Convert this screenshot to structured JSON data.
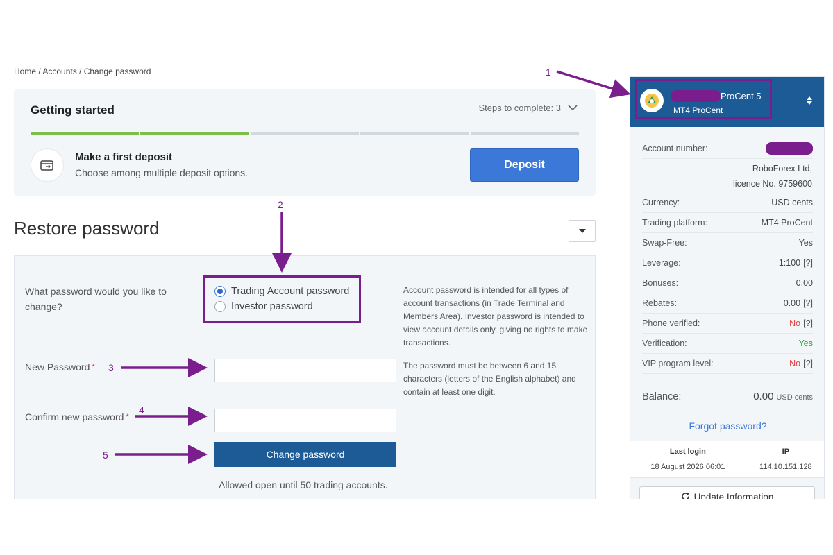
{
  "breadcrumb": "Home / Accounts / Change password",
  "getting_started": {
    "title": "Getting started",
    "steps_label": "Steps to complete: 3",
    "progress": {
      "completed": 2,
      "total": 5
    },
    "deposit_title": "Make a first deposit",
    "deposit_subtitle": "Choose among multiple deposit options.",
    "deposit_button": "Deposit"
  },
  "restore": {
    "title": "Restore password",
    "question": "What password would you like to change?",
    "options": [
      {
        "label": "Trading Account password",
        "selected": true
      },
      {
        "label": "Investor password",
        "selected": false
      }
    ],
    "help_account": "Account password is intended for all types of account transactions (in Trade Terminal and Members Area). Investor password is intended to view account details only, giving no rights to make transactions.",
    "new_password_label": "New Password",
    "confirm_password_label": "Confirm new password",
    "required_mark": "*",
    "help_password": "The password must be between 6 and 15 characters (letters of the English alphabet) and contain at least one digit.",
    "change_button": "Change password",
    "allowed_note": "Allowed open until 50 trading accounts."
  },
  "annotations": [
    "1",
    "2",
    "3",
    "4",
    "5"
  ],
  "account": {
    "name_suffix": "ProCent 5",
    "platform_badge": "MT4 ProCent",
    "number_label": "Account number:",
    "company": "RoboForex Ltd,",
    "licence": "licence No. 9759600",
    "rows": [
      {
        "label": "Currency:",
        "value": "USD cents"
      },
      {
        "label": "Trading platform:",
        "value": "MT4 ProCent"
      },
      {
        "label": "Swap-Free:",
        "value": "Yes"
      },
      {
        "label": "Leverage:",
        "value": "1:100",
        "help": "[?]"
      },
      {
        "label": "Bonuses:",
        "value": "0.00"
      },
      {
        "label": "Rebates:",
        "value": "0.00",
        "help": "[?]"
      },
      {
        "label": "Phone verified:",
        "value": "No",
        "help": "[?]"
      },
      {
        "label": "Verification:",
        "value": "Yes"
      },
      {
        "label": "VIP program level:",
        "value": "No",
        "help": "[?]"
      }
    ],
    "balance_label": "Balance:",
    "balance_value": "0.00",
    "balance_unit": "USD cents",
    "forgot_password": "Forgot password?",
    "last_login_label": "Last login",
    "last_login_value": "18 August 2026 06:01",
    "ip_label": "IP",
    "ip_value": "114.10.151.128",
    "update_button": "Update Information"
  },
  "colors": {
    "accent_blue": "#3b78d8",
    "header_blue": "#1d5b96",
    "progress_done": "#7cc04b",
    "progress_todo": "#d3d8dd",
    "annotation": "#7a1e8e",
    "no_red": "#e23b3b",
    "yes_green": "#2aa340"
  }
}
